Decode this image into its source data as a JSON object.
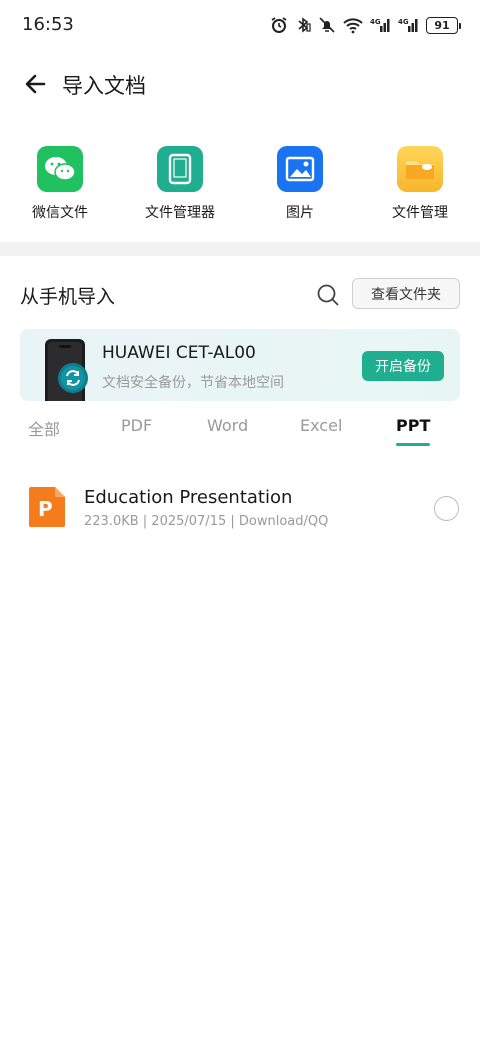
{
  "status_bar": {
    "time": "16:53",
    "battery": "91",
    "icons": [
      "alarm-icon",
      "bluetooth-icon",
      "mute-icon",
      "wifi-icon",
      "signal-4g-icon",
      "signal-4g-icon"
    ]
  },
  "header": {
    "title": "导入文档"
  },
  "sources": [
    {
      "label": "微信文件",
      "icon": "wechat-icon",
      "color": "#1fc160"
    },
    {
      "label": "文件管理器",
      "icon": "tablet-icon",
      "color": "#1fae8f"
    },
    {
      "label": "图片",
      "icon": "image-icon",
      "color": "#1a73f0"
    },
    {
      "label": "文件管理",
      "icon": "folder-icon",
      "color": "#f7b62a"
    }
  ],
  "import_section": {
    "title": "从手机导入",
    "view_folder_label": "查看文件夹"
  },
  "backup_banner": {
    "device_name": "HUAWEI CET-AL00",
    "description": "文档安全备份，节省本地空间",
    "button_label": "开启备份"
  },
  "tabs": [
    {
      "label": "全部",
      "active": false
    },
    {
      "label": "PDF",
      "active": false
    },
    {
      "label": "Word",
      "active": false
    },
    {
      "label": "Excel",
      "active": false
    },
    {
      "label": "PPT",
      "active": true
    }
  ],
  "files": [
    {
      "name": "Education Presentation",
      "meta": "223.0KB | 2025/07/15 | Download/QQ",
      "type": "ppt-icon",
      "type_letter": "P",
      "selected": false
    }
  ],
  "colors": {
    "accent": "#1fae8f",
    "ppt": "#f47c1c"
  }
}
